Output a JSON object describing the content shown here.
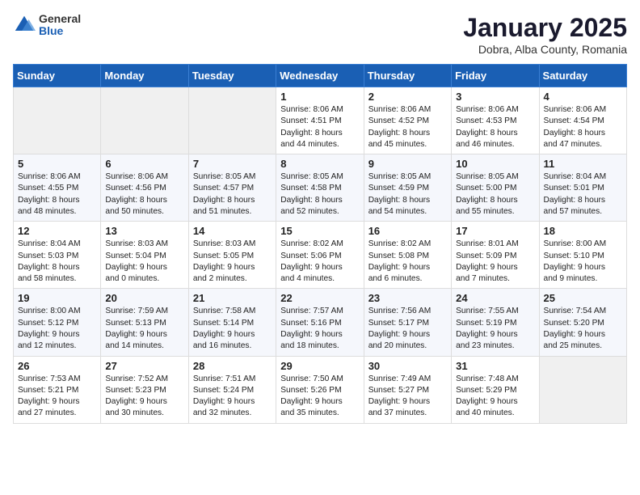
{
  "logo": {
    "general": "General",
    "blue": "Blue"
  },
  "title": "January 2025",
  "subtitle": "Dobra, Alba County, Romania",
  "days_of_week": [
    "Sunday",
    "Monday",
    "Tuesday",
    "Wednesday",
    "Thursday",
    "Friday",
    "Saturday"
  ],
  "weeks": [
    [
      {
        "day": "",
        "info": ""
      },
      {
        "day": "",
        "info": ""
      },
      {
        "day": "",
        "info": ""
      },
      {
        "day": "1",
        "info": "Sunrise: 8:06 AM\nSunset: 4:51 PM\nDaylight: 8 hours\nand 44 minutes."
      },
      {
        "day": "2",
        "info": "Sunrise: 8:06 AM\nSunset: 4:52 PM\nDaylight: 8 hours\nand 45 minutes."
      },
      {
        "day": "3",
        "info": "Sunrise: 8:06 AM\nSunset: 4:53 PM\nDaylight: 8 hours\nand 46 minutes."
      },
      {
        "day": "4",
        "info": "Sunrise: 8:06 AM\nSunset: 4:54 PM\nDaylight: 8 hours\nand 47 minutes."
      }
    ],
    [
      {
        "day": "5",
        "info": "Sunrise: 8:06 AM\nSunset: 4:55 PM\nDaylight: 8 hours\nand 48 minutes."
      },
      {
        "day": "6",
        "info": "Sunrise: 8:06 AM\nSunset: 4:56 PM\nDaylight: 8 hours\nand 50 minutes."
      },
      {
        "day": "7",
        "info": "Sunrise: 8:05 AM\nSunset: 4:57 PM\nDaylight: 8 hours\nand 51 minutes."
      },
      {
        "day": "8",
        "info": "Sunrise: 8:05 AM\nSunset: 4:58 PM\nDaylight: 8 hours\nand 52 minutes."
      },
      {
        "day": "9",
        "info": "Sunrise: 8:05 AM\nSunset: 4:59 PM\nDaylight: 8 hours\nand 54 minutes."
      },
      {
        "day": "10",
        "info": "Sunrise: 8:05 AM\nSunset: 5:00 PM\nDaylight: 8 hours\nand 55 minutes."
      },
      {
        "day": "11",
        "info": "Sunrise: 8:04 AM\nSunset: 5:01 PM\nDaylight: 8 hours\nand 57 minutes."
      }
    ],
    [
      {
        "day": "12",
        "info": "Sunrise: 8:04 AM\nSunset: 5:03 PM\nDaylight: 8 hours\nand 58 minutes."
      },
      {
        "day": "13",
        "info": "Sunrise: 8:03 AM\nSunset: 5:04 PM\nDaylight: 9 hours\nand 0 minutes."
      },
      {
        "day": "14",
        "info": "Sunrise: 8:03 AM\nSunset: 5:05 PM\nDaylight: 9 hours\nand 2 minutes."
      },
      {
        "day": "15",
        "info": "Sunrise: 8:02 AM\nSunset: 5:06 PM\nDaylight: 9 hours\nand 4 minutes."
      },
      {
        "day": "16",
        "info": "Sunrise: 8:02 AM\nSunset: 5:08 PM\nDaylight: 9 hours\nand 6 minutes."
      },
      {
        "day": "17",
        "info": "Sunrise: 8:01 AM\nSunset: 5:09 PM\nDaylight: 9 hours\nand 7 minutes."
      },
      {
        "day": "18",
        "info": "Sunrise: 8:00 AM\nSunset: 5:10 PM\nDaylight: 9 hours\nand 9 minutes."
      }
    ],
    [
      {
        "day": "19",
        "info": "Sunrise: 8:00 AM\nSunset: 5:12 PM\nDaylight: 9 hours\nand 12 minutes."
      },
      {
        "day": "20",
        "info": "Sunrise: 7:59 AM\nSunset: 5:13 PM\nDaylight: 9 hours\nand 14 minutes."
      },
      {
        "day": "21",
        "info": "Sunrise: 7:58 AM\nSunset: 5:14 PM\nDaylight: 9 hours\nand 16 minutes."
      },
      {
        "day": "22",
        "info": "Sunrise: 7:57 AM\nSunset: 5:16 PM\nDaylight: 9 hours\nand 18 minutes."
      },
      {
        "day": "23",
        "info": "Sunrise: 7:56 AM\nSunset: 5:17 PM\nDaylight: 9 hours\nand 20 minutes."
      },
      {
        "day": "24",
        "info": "Sunrise: 7:55 AM\nSunset: 5:19 PM\nDaylight: 9 hours\nand 23 minutes."
      },
      {
        "day": "25",
        "info": "Sunrise: 7:54 AM\nSunset: 5:20 PM\nDaylight: 9 hours\nand 25 minutes."
      }
    ],
    [
      {
        "day": "26",
        "info": "Sunrise: 7:53 AM\nSunset: 5:21 PM\nDaylight: 9 hours\nand 27 minutes."
      },
      {
        "day": "27",
        "info": "Sunrise: 7:52 AM\nSunset: 5:23 PM\nDaylight: 9 hours\nand 30 minutes."
      },
      {
        "day": "28",
        "info": "Sunrise: 7:51 AM\nSunset: 5:24 PM\nDaylight: 9 hours\nand 32 minutes."
      },
      {
        "day": "29",
        "info": "Sunrise: 7:50 AM\nSunset: 5:26 PM\nDaylight: 9 hours\nand 35 minutes."
      },
      {
        "day": "30",
        "info": "Sunrise: 7:49 AM\nSunset: 5:27 PM\nDaylight: 9 hours\nand 37 minutes."
      },
      {
        "day": "31",
        "info": "Sunrise: 7:48 AM\nSunset: 5:29 PM\nDaylight: 9 hours\nand 40 minutes."
      },
      {
        "day": "",
        "info": ""
      }
    ]
  ]
}
